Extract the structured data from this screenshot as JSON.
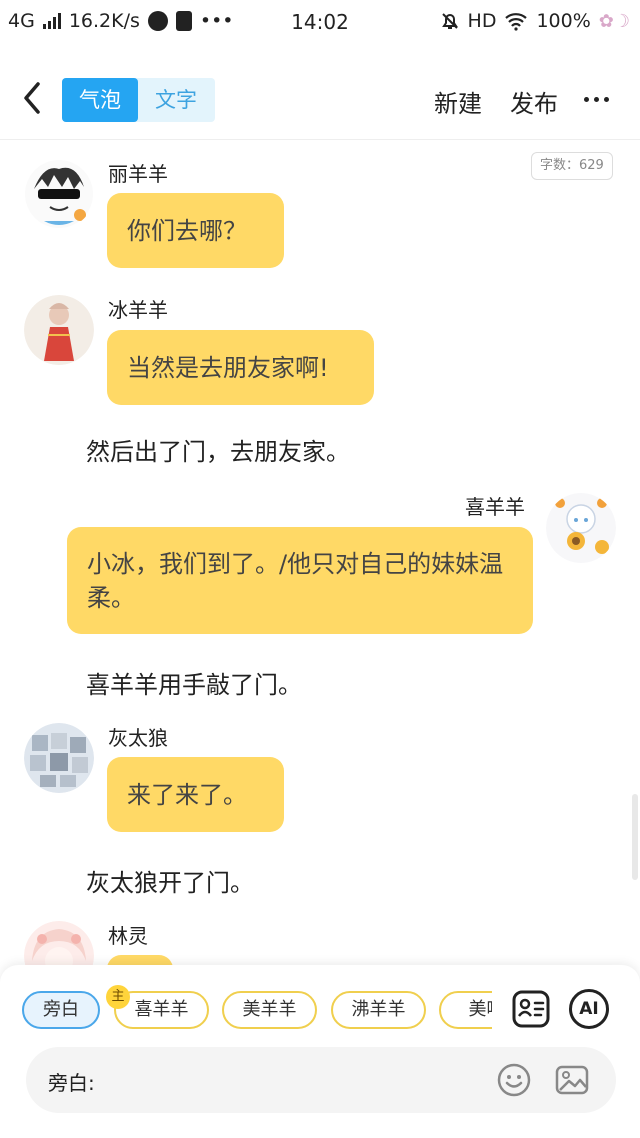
{
  "status_bar": {
    "network": "4G",
    "speed": "16.2K/s",
    "more": "•••",
    "time": "14:02",
    "hd": "HD",
    "battery": "100%"
  },
  "nav": {
    "tabs": [
      {
        "label": "气泡",
        "active": true
      },
      {
        "label": "文字",
        "active": false
      }
    ],
    "new_label": "新建",
    "publish_label": "发布"
  },
  "word_count": "字数：629",
  "messages": [
    {
      "type": "bubble",
      "side": "left",
      "name": "丽羊羊",
      "text": "你们去哪？",
      "avatar": "avatar-sunglasses-character"
    },
    {
      "type": "bubble",
      "side": "left",
      "name": "冰羊羊",
      "text": "当然是去朋友家啊!",
      "avatar": "avatar-girl-red-dress"
    },
    {
      "type": "narration",
      "text": "然后出了门，去朋友家。"
    },
    {
      "type": "bubble",
      "side": "right",
      "name": "喜羊羊",
      "text": "小冰，我们到了。/他只对自己的妹妹温柔。",
      "avatar": "avatar-white-hair-sunflower"
    },
    {
      "type": "narration",
      "text": "喜羊羊用手敲了门。"
    },
    {
      "type": "bubble",
      "side": "left",
      "name": "灰太狼",
      "text": "来了来了。",
      "avatar": "avatar-collage"
    },
    {
      "type": "narration",
      "text": "灰太狼开了门。"
    },
    {
      "type": "bubble",
      "side": "left",
      "name": "林灵",
      "text": "",
      "avatar": "avatar-pink-hair"
    }
  ],
  "roles": [
    {
      "label": "旁白",
      "active": true
    },
    {
      "label": "喜羊羊",
      "active": false,
      "badge": "主"
    },
    {
      "label": "美羊羊",
      "active": false
    },
    {
      "label": "沸羊羊",
      "active": false
    },
    {
      "label": "美喵",
      "active": false
    }
  ],
  "input": {
    "prefix": "旁白:"
  },
  "ai_label": "AI",
  "colors": {
    "bubble": "#ffd966",
    "accent": "#25a5f2",
    "role_border": "#f0cf4e"
  }
}
